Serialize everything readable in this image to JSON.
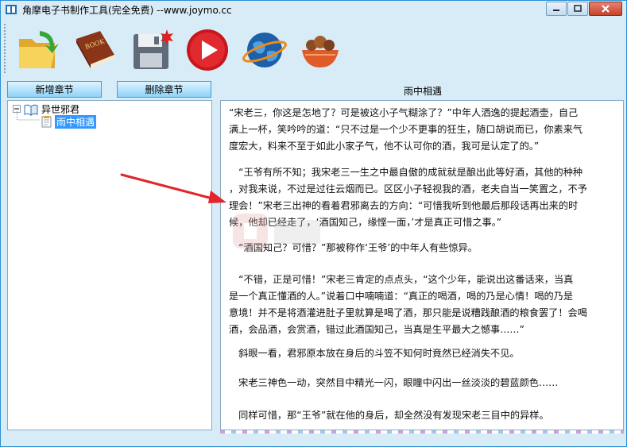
{
  "window": {
    "title": "角摩电子书制作工具(完全免费) --www.joymo.cc",
    "minimize_icon": "minimize-icon",
    "maximize_icon": "maximize-icon",
    "close_icon": "close-icon"
  },
  "toolbar": {
    "items": [
      {
        "icon": "open-folder-icon"
      },
      {
        "icon": "book-icon"
      },
      {
        "icon": "save-disk-icon"
      },
      {
        "icon": "play-icon"
      },
      {
        "icon": "globe-icon"
      },
      {
        "icon": "basket-icon"
      }
    ]
  },
  "sections": {
    "add_label": "新增章节",
    "delete_label": "删除章节"
  },
  "tree": {
    "book": "异世邪君",
    "chapter": "雨中相遇"
  },
  "editor": {
    "title": "雨中相遇",
    "paragraphs": [
      [
        "“宋老三，你这是怎地了？可是被这小子气糊涂了？”中年人洒逸的提起酒壶，自己",
        "满上一杯，笑吟吟的道：“只不过是一个少不更事的狂生，随口胡说而已，你素来气",
        "度宏大，料来不至于如此小家子气，他不认可你的酒，我可是认定了的。”"
      ],
      [
        "　“王爷有所不知；我宋老三一生之中最自傲的成就就是酿出此等好酒，其他的种种",
        "，对我来说，不过是过往云烟而已。区区小子轻视我的酒，老夫自当一笑置之，不予",
        "理会！”宋老三出神的看着君邪离去的方向：“可惜我听到他最后那段话再出来的时",
        "候，他却已经走了，‘酒国知己，缘悭一面，’才是真正可惜之事。”"
      ],
      [
        "　“酒国知己？可惜？”那被称作‘王爷’的中年人有些惊异。"
      ],
      [
        "　“不错，正是可惜！”宋老三肯定的点点头，“这个少年，能说出这番话来，当真",
        "是一个真正懂酒的人。”说着口中喃喃道：“真正的喝酒，喝的乃是心情！喝的乃是",
        "意境！并不是将酒灌进肚子里就算是喝了酒，那只能是说糟践酿酒的粮食罢了！会喝",
        "酒，会品酒，会赏酒，错过此酒国知己，当真是生平最大之憾事……”"
      ],
      [
        "　斜眼一看，君邪原本放在身后的斗笠不知何时竟然已经消失不见。"
      ],
      [
        "　宋老三神色一动，突然目中精光一闪，眼瞳中闪出一丝淡淡的碧蓝颜色……"
      ],
      [
        "　同样可惜，那“王爷”就在他的身后，却全然没有发现宋老三目中的异样。"
      ]
    ]
  }
}
